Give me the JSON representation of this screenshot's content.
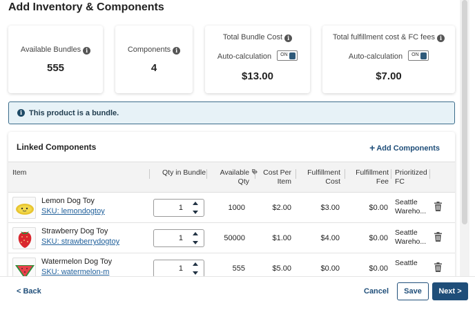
{
  "page": {
    "title": "Add Inventory & Components"
  },
  "cards": [
    {
      "label": "Available Bundles",
      "value": "555"
    },
    {
      "label": "Components",
      "value": "4"
    },
    {
      "label": "Total Bundle Cost",
      "auto_label": "Auto-calculation",
      "toggle": "ON",
      "value": "$13.00"
    },
    {
      "label": "Total fulfillment cost & FC fees",
      "auto_label": "Auto-calculation",
      "toggle": "ON",
      "value": "$7.00"
    }
  ],
  "banner": {
    "text": "This product is a bundle."
  },
  "panel": {
    "title": "Linked Components",
    "add_label": "Add Components",
    "columns": {
      "item": "Item",
      "qty": "Qty in Bundle",
      "available_1": "Available",
      "available_2": "Qty",
      "cost_1": "Cost Per",
      "cost_2": "Item",
      "fulfill_1": "Fulfillment",
      "fulfill_2": "Cost",
      "fee_1": "Fulfillment",
      "fee_2": "Fee",
      "fc_1": "Prioritized",
      "fc_2": "FC"
    },
    "rows": [
      {
        "name": "Lemon Dog Toy",
        "sku": "SKU: lemondogtoy",
        "qty": "1",
        "available": "1000",
        "cost": "$2.00",
        "fulfillment": "$3.00",
        "fee": "$0.00",
        "fc_1": "Seattle",
        "fc_2": "Wareho..."
      },
      {
        "name": "Strawberry Dog Toy",
        "sku": "SKU: strawberrydogtoy",
        "qty": "1",
        "available": "50000",
        "cost": "$1.00",
        "fulfillment": "$4.00",
        "fee": "$0.00",
        "fc_1": "Seattle",
        "fc_2": "Wareho..."
      },
      {
        "name": "Watermelon Dog Toy",
        "sku": "SKU: watermelon-m",
        "qty": "1",
        "available": "555",
        "cost": "$5.00",
        "fulfillment": "$0.00",
        "fee": "$0.00",
        "fc_1": "Seattle",
        "fc_2": ""
      }
    ]
  },
  "footer": {
    "back": "< Back",
    "cancel": "Cancel",
    "save": "Save",
    "next": "Next >"
  },
  "colors": {
    "primary": "#1f4e79",
    "banner_bg": "#e7f2f7",
    "link": "#1f5f9a"
  },
  "icons": [
    "info-icon",
    "toggle-switch",
    "plus-icon",
    "tag-icon",
    "chevron-up-icon",
    "chevron-down-icon",
    "trash-icon"
  ]
}
